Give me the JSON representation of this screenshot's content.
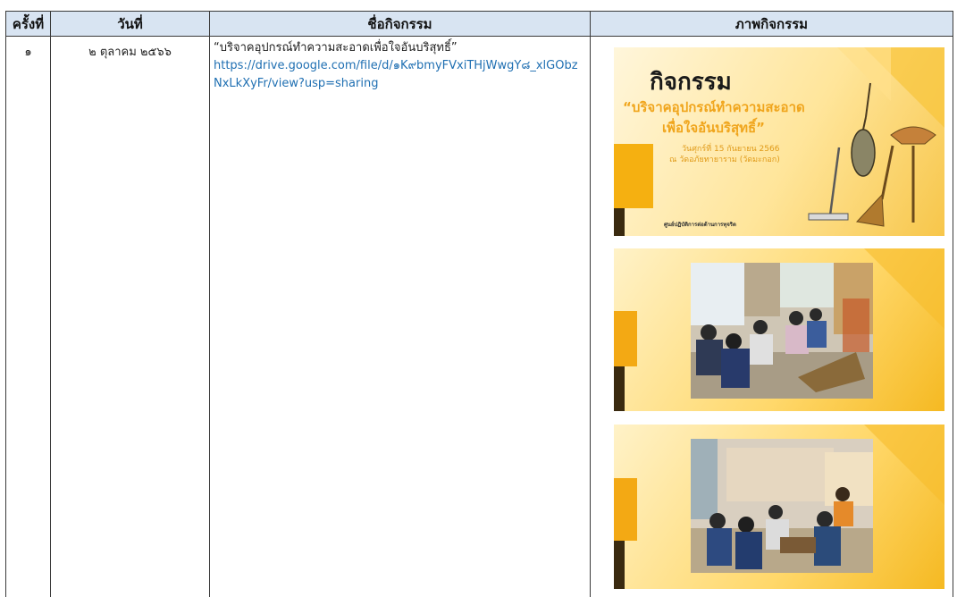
{
  "table": {
    "headers": {
      "no": "ครั้งที่",
      "date": "วันที่",
      "name": "ชื่อกิจกรรม",
      "pics": "ภาพกิจกรรม"
    },
    "rows": [
      {
        "no": "๑",
        "date": "๒ ตุลาคม ๒๕๖๖",
        "name": "“บริจาคอุปกรณ์ทำความสะอาดเพื่อใจอันบริสุทธิ์”",
        "link": "https://drive.google.com/file/d/๑K๙bmyFVxiTHjWwgY๘_xlGObzNxLkXyFr/view?usp=sharing"
      }
    ]
  },
  "poster": {
    "title": "กิจกรรม",
    "line1": "“บริจาคอุปกรณ์ทำความสะอาด",
    "line2": "เพื่อใจอันบริสุทธิ์”",
    "line3": "วันศุกร์ที่ 15 กันยายน 2566",
    "line4": "ณ วัดอภัยทายาราม (วัดมะกอก)",
    "footer": "ศูนย์ปฏิบัติการต่อต้านการทุจริต"
  },
  "colors": {
    "header_bg": "#d8e4f2",
    "link": "#1f6fb2",
    "accent_yellow": "#f5b011",
    "poster_orange": "#f0a51c"
  },
  "icons": [
    "duster-icon",
    "mop-icon",
    "broom-icon"
  ]
}
